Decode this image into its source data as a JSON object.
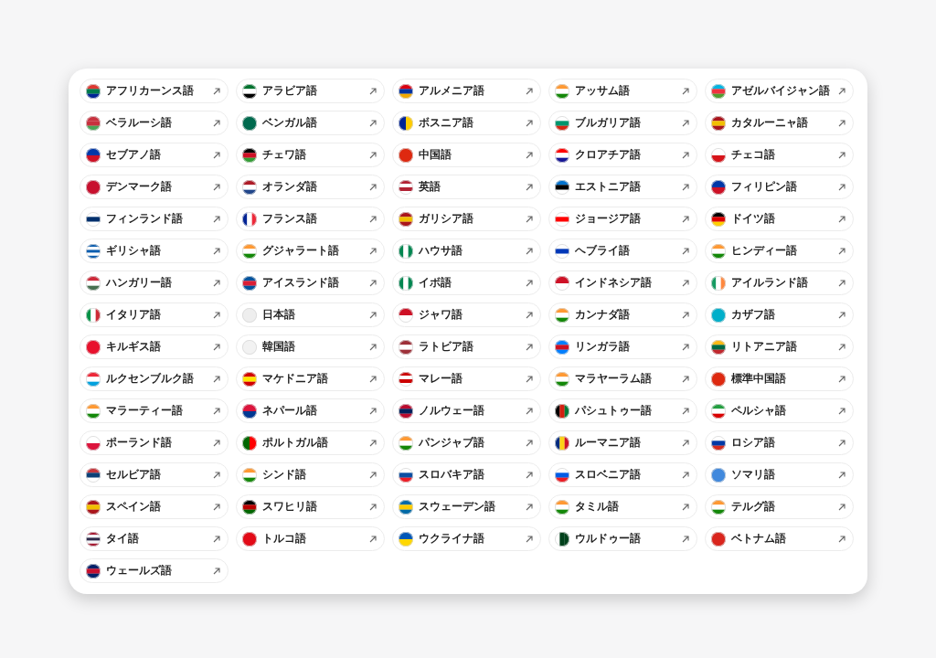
{
  "languages": [
    {
      "name": "アフリカーンス語"
    },
    {
      "name": "アラビア語"
    },
    {
      "name": "アルメニア語"
    },
    {
      "name": "アッサム語"
    },
    {
      "name": "アゼルバイジャン語"
    },
    {
      "name": "ベラルーシ語"
    },
    {
      "name": "ベンガル語"
    },
    {
      "name": "ボスニア語"
    },
    {
      "name": "ブルガリア語"
    },
    {
      "name": "カタルーニャ語"
    },
    {
      "name": "セブアノ語"
    },
    {
      "name": "チェワ語"
    },
    {
      "name": "中国語"
    },
    {
      "name": "クロアチア語"
    },
    {
      "name": "チェコ語"
    },
    {
      "name": "デンマーク語"
    },
    {
      "name": "オランダ語"
    },
    {
      "name": "英語"
    },
    {
      "name": "エストニア語"
    },
    {
      "name": "フィリピン語"
    },
    {
      "name": "フィンランド語"
    },
    {
      "name": "フランス語"
    },
    {
      "name": "ガリシア語"
    },
    {
      "name": "ジョージア語"
    },
    {
      "name": "ドイツ語"
    },
    {
      "name": "ギリシャ語"
    },
    {
      "name": "グジャラート語"
    },
    {
      "name": "ハウサ語"
    },
    {
      "name": "ヘブライ語"
    },
    {
      "name": "ヒンディー語"
    },
    {
      "name": "ハンガリー語"
    },
    {
      "name": "アイスランド語"
    },
    {
      "name": "イボ語"
    },
    {
      "name": "インドネシア語"
    },
    {
      "name": "アイルランド語"
    },
    {
      "name": "イタリア語"
    },
    {
      "name": "日本語"
    },
    {
      "name": "ジャワ語"
    },
    {
      "name": "カンナダ語"
    },
    {
      "name": "カザフ語"
    },
    {
      "name": "キルギス語"
    },
    {
      "name": "韓国語"
    },
    {
      "name": "ラトビア語"
    },
    {
      "name": "リンガラ語"
    },
    {
      "name": "リトアニア語"
    },
    {
      "name": "ルクセンブルク語"
    },
    {
      "name": "マケドニア語"
    },
    {
      "name": "マレー語"
    },
    {
      "name": "マラヤーラム語"
    },
    {
      "name": "標準中国語"
    },
    {
      "name": "マラーティー語"
    },
    {
      "name": "ネパール語"
    },
    {
      "name": "ノルウェー語"
    },
    {
      "name": "パシュトゥー語"
    },
    {
      "name": "ペルシャ語"
    },
    {
      "name": "ポーランド語"
    },
    {
      "name": "ポルトガル語"
    },
    {
      "name": "パンジャブ語"
    },
    {
      "name": "ルーマニア語"
    },
    {
      "name": "ロシア語"
    },
    {
      "name": "セルビア語"
    },
    {
      "name": "シンド語"
    },
    {
      "name": "スロバキア語"
    },
    {
      "name": "スロベニア語"
    },
    {
      "name": "ソマリ語"
    },
    {
      "name": "スペイン語"
    },
    {
      "name": "スワヒリ語"
    },
    {
      "name": "スウェーデン語"
    },
    {
      "name": "タミル語"
    },
    {
      "name": "テルグ語"
    },
    {
      "name": "タイ語"
    },
    {
      "name": "トルコ語"
    },
    {
      "name": "ウクライナ語"
    },
    {
      "name": "ウルドゥー語"
    },
    {
      "name": "ベトナム語"
    },
    {
      "name": "ウェールズ語"
    }
  ]
}
